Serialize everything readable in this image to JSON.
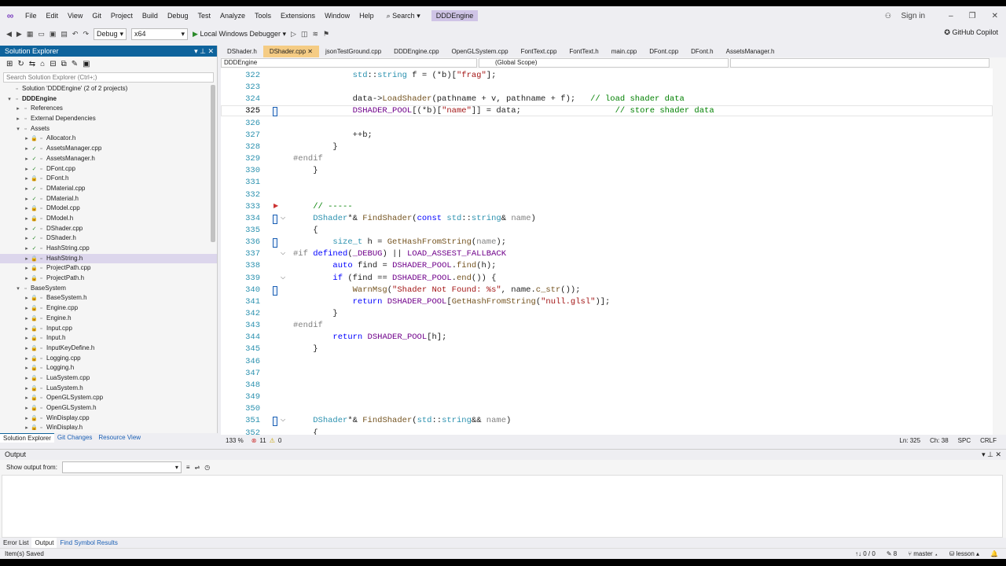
{
  "menu": [
    "File",
    "Edit",
    "View",
    "Git",
    "Project",
    "Build",
    "Debug",
    "Test",
    "Analyze",
    "Tools",
    "Extensions",
    "Window",
    "Help"
  ],
  "search": {
    "label": "Search",
    "caret": "▾"
  },
  "solution_name": "DDDEngine",
  "signin": "Sign in",
  "toolbar": {
    "config": "Debug",
    "platform": "x64",
    "debugger": "Local Windows Debugger",
    "copilot": "GitHub Copilot"
  },
  "solution_explorer": {
    "title": "Solution Explorer",
    "search_placeholder": "Search Solution Explorer (Ctrl+;)",
    "items": [
      {
        "label": "Solution 'DDDEngine' (2 of 2 projects)",
        "indent": 1,
        "exp": "",
        "marker": ""
      },
      {
        "label": "DDDEngine",
        "indent": 1,
        "exp": "▾",
        "marker": "",
        "bold": true
      },
      {
        "label": "References",
        "indent": 2,
        "exp": "▸",
        "marker": ""
      },
      {
        "label": "External Dependencies",
        "indent": 2,
        "exp": "▸",
        "marker": ""
      },
      {
        "label": "Assets",
        "indent": 2,
        "exp": "▾",
        "marker": ""
      },
      {
        "label": "Allocator.h",
        "indent": 3,
        "exp": "▸",
        "marker": "lock"
      },
      {
        "label": "AssetsManager.cpp",
        "indent": 3,
        "exp": "▸",
        "marker": "check"
      },
      {
        "label": "AssetsManager.h",
        "indent": 3,
        "exp": "▸",
        "marker": "check"
      },
      {
        "label": "DFont.cpp",
        "indent": 3,
        "exp": "▸",
        "marker": "check"
      },
      {
        "label": "DFont.h",
        "indent": 3,
        "exp": "▸",
        "marker": "lock"
      },
      {
        "label": "DMaterial.cpp",
        "indent": 3,
        "exp": "▸",
        "marker": "check"
      },
      {
        "label": "DMaterial.h",
        "indent": 3,
        "exp": "▸",
        "marker": "check"
      },
      {
        "label": "DModel.cpp",
        "indent": 3,
        "exp": "▸",
        "marker": "lock"
      },
      {
        "label": "DModel.h",
        "indent": 3,
        "exp": "▸",
        "marker": "lock"
      },
      {
        "label": "DShader.cpp",
        "indent": 3,
        "exp": "▸",
        "marker": "check"
      },
      {
        "label": "DShader.h",
        "indent": 3,
        "exp": "▸",
        "marker": "check"
      },
      {
        "label": "HashString.cpp",
        "indent": 3,
        "exp": "▸",
        "marker": "check"
      },
      {
        "label": "HashString.h",
        "indent": 3,
        "exp": "▸",
        "marker": "lock",
        "selected": true
      },
      {
        "label": "ProjectPath.cpp",
        "indent": 3,
        "exp": "▸",
        "marker": "lock"
      },
      {
        "label": "ProjectPath.h",
        "indent": 3,
        "exp": "▸",
        "marker": "lock"
      },
      {
        "label": "BaseSystem",
        "indent": 2,
        "exp": "▾",
        "marker": ""
      },
      {
        "label": "BaseSystem.h",
        "indent": 3,
        "exp": "▸",
        "marker": "lock"
      },
      {
        "label": "Engine.cpp",
        "indent": 3,
        "exp": "▸",
        "marker": "lock"
      },
      {
        "label": "Engine.h",
        "indent": 3,
        "exp": "▸",
        "marker": "lock"
      },
      {
        "label": "Input.cpp",
        "indent": 3,
        "exp": "▸",
        "marker": "lock"
      },
      {
        "label": "Input.h",
        "indent": 3,
        "exp": "▸",
        "marker": "lock"
      },
      {
        "label": "InputKeyDefine.h",
        "indent": 3,
        "exp": "▸",
        "marker": "lock"
      },
      {
        "label": "Logging.cpp",
        "indent": 3,
        "exp": "▸",
        "marker": "lock"
      },
      {
        "label": "Logging.h",
        "indent": 3,
        "exp": "▸",
        "marker": "lock"
      },
      {
        "label": "LuaSystem.cpp",
        "indent": 3,
        "exp": "▸",
        "marker": "lock"
      },
      {
        "label": "LuaSystem.h",
        "indent": 3,
        "exp": "▸",
        "marker": "lock"
      },
      {
        "label": "OpenGLSystem.cpp",
        "indent": 3,
        "exp": "▸",
        "marker": "lock"
      },
      {
        "label": "OpenGLSystem.h",
        "indent": 3,
        "exp": "▸",
        "marker": "lock"
      },
      {
        "label": "WinDisplay.cpp",
        "indent": 3,
        "exp": "▸",
        "marker": "lock"
      },
      {
        "label": "WinDisplay.h",
        "indent": 3,
        "exp": "▸",
        "marker": "lock"
      }
    ],
    "tabs": [
      "Solution Explorer",
      "Git Changes",
      "Resource View"
    ]
  },
  "editor": {
    "tabs": [
      "DShader.h",
      "DShader.cpp",
      "jsonTestGround.cpp",
      "DDDEngine.cpp",
      "OpenGLSystem.cpp",
      "FontText.cpp",
      "FontText.h",
      "main.cpp",
      "DFont.cpp",
      "DFont.h",
      "AssetsManager.h"
    ],
    "active_tab": 1,
    "nav_project": "DDDEngine",
    "nav_scope": "(Global Scope)",
    "zoom": "133 %",
    "errors": "11",
    "warnings": "0",
    "ln": "Ln: 325",
    "ch": "Ch: 38",
    "spc": "SPC",
    "crlf": "CRLF"
  },
  "code_lines": [
    {
      "n": "322",
      "html": "            <span class=\"ty\">std</span>::<span class=\"ty\">string</span> f = (*b)[<span class=\"st\">\"frag\"</span>];"
    },
    {
      "n": "323",
      "html": ""
    },
    {
      "n": "324",
      "html": "            data-&gt;<span class=\"fn\">LoadShader</span>(pathname + v, pathname + f);   <span class=\"cm\">// load shader data</span>"
    },
    {
      "n": "325",
      "html": "            <span class=\"mac\">DSHADER_POOL</span>[(*b)[<span class=\"st\">\"name\"</span>]] = data;                   <span class=\"cm\">// store shader data</span>"
    },
    {
      "n": "326",
      "html": ""
    },
    {
      "n": "327",
      "html": "            ++b;"
    },
    {
      "n": "328",
      "html": "        }"
    },
    {
      "n": "329",
      "html": "<span class=\"gr\">#endif</span>"
    },
    {
      "n": "330",
      "html": "    }"
    },
    {
      "n": "331",
      "html": ""
    },
    {
      "n": "332",
      "html": ""
    },
    {
      "n": "333",
      "html": "    <span class=\"cm\">// -----</span>"
    },
    {
      "n": "334",
      "html": "    <span class=\"ty\">DShader</span>*&amp; <span class=\"fn\">FindShader</span>(<span class=\"kw\">const</span> <span class=\"ty\">std</span>::<span class=\"ty\">string</span>&amp; <span class=\"gr\">name</span>)"
    },
    {
      "n": "335",
      "html": "    {"
    },
    {
      "n": "336",
      "html": "        <span class=\"ty\">size_t</span> h = <span class=\"fn\">GetHashFromString</span>(<span class=\"gr\">name</span>);"
    },
    {
      "n": "337",
      "html": "<span class=\"gr\">#if</span> <span class=\"kw\">defined</span>(<span class=\"mac\">_DEBUG</span>) || <span class=\"mac\">LOAD_ASSEST_FALLBACK</span>"
    },
    {
      "n": "338",
      "html": "        <span class=\"kw\">auto</span> find = <span class=\"mac\">DSHADER_POOL</span>.<span class=\"fn\">find</span>(h);"
    },
    {
      "n": "339",
      "html": "        <span class=\"kw\">if</span> (find == <span class=\"mac\">DSHADER_POOL</span>.<span class=\"fn\">end</span>()) {"
    },
    {
      "n": "340",
      "html": "            <span class=\"fn\">WarnMsg</span>(<span class=\"st\">\"Shader Not Found: %s\"</span>, name.<span class=\"fn\">c_str</span>());"
    },
    {
      "n": "341",
      "html": "            <span class=\"kw\">return</span> <span class=\"mac\">DSHADER_POOL</span>[<span class=\"fn\">GetHashFromString</span>(<span class=\"st\">\"null.glsl\"</span>)];"
    },
    {
      "n": "342",
      "html": "        }"
    },
    {
      "n": "343",
      "html": "<span class=\"gr\">#endif</span>"
    },
    {
      "n": "344",
      "html": "        <span class=\"kw\">return</span> <span class=\"mac\">DSHADER_POOL</span>[h];"
    },
    {
      "n": "345",
      "html": "    }"
    },
    {
      "n": "346",
      "html": ""
    },
    {
      "n": "347",
      "html": ""
    },
    {
      "n": "348",
      "html": ""
    },
    {
      "n": "349",
      "html": ""
    },
    {
      "n": "350",
      "html": ""
    },
    {
      "n": "351",
      "html": "    <span class=\"ty\">DShader</span>*&amp; <span class=\"fn\">FindShader</span>(<span class=\"ty\">std</span>::<span class=\"ty\">string</span>&amp;&amp; <span class=\"gr\">name</span>)"
    },
    {
      "n": "352",
      "html": "    {"
    }
  ],
  "output": {
    "title": "Output",
    "show_label": "Show output from:"
  },
  "bottom_tabs": [
    "Error List",
    "Output",
    "Find Symbol Results"
  ],
  "status": {
    "left": "Item(s) Saved",
    "counts": "↑↓ 0 / 0",
    "pencil": "8",
    "branch": "master",
    "repo": "lesson"
  }
}
